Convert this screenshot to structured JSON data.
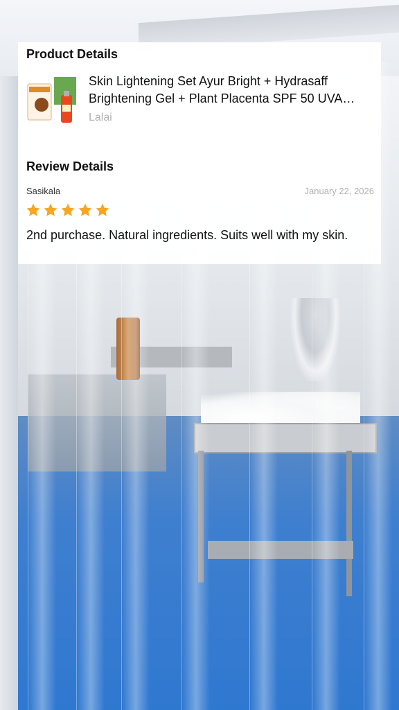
{
  "product_details": {
    "heading": "Product Details",
    "product_name": "Skin Lightening Set Ayur Bright + Hydrasaff Brightening Gel + Plant Placenta SPF 50 UVA…",
    "brand": "Lalai",
    "thumbnail_icon": "product-thumbnail"
  },
  "review_details": {
    "heading": "Review Details",
    "reviewer": "Sasikala",
    "date": "January 22, 2026",
    "rating": 5,
    "rating_max": 5,
    "star_color": "#f5a623",
    "text": "2nd purchase.  Natural ingredients.  Suits well with my skin."
  }
}
